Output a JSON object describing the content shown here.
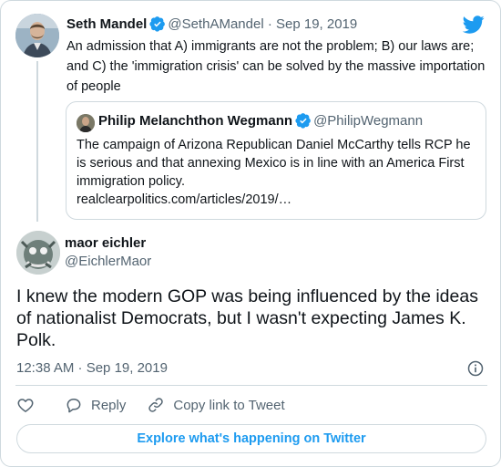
{
  "parent_tweet": {
    "name": "Seth Mandel",
    "handle": "@SethAMandel",
    "separator": "·",
    "date": "Sep 19, 2019",
    "text": "An admission that A) immigrants are not the problem; B) our laws are; and C) the 'immigration crisis' can be solved by the massive importation of people"
  },
  "quoted_tweet": {
    "name": "Philip Melanchthon Wegmann",
    "handle": "@PhilipWegmann",
    "text": "The campaign of Arizona Republican Daniel McCarthy tells RCP he is serious and that annexing Mexico is in line with an America First immigration policy.",
    "link": "realclearpolitics.com/articles/2019/…"
  },
  "main_tweet": {
    "name": "maor eichler",
    "handle": "@EichlerMaor",
    "text": "I knew the modern GOP was being influenced by the ideas of nationalist Democrats, but I wasn't expecting James K. Polk.",
    "timestamp": "12:38 AM · Sep 19, 2019"
  },
  "actions": {
    "reply": "Reply",
    "copy_link": "Copy link to Tweet"
  },
  "explore_label": "Explore what's happening on Twitter",
  "colors": {
    "brand_blue": "#1d9bf0",
    "verified_blue": "#1d9bf0",
    "muted_text": "#536471",
    "border": "#cfd9de"
  },
  "icons": [
    "twitter-bird-icon",
    "verified-badge-icon",
    "info-icon",
    "heart-icon",
    "reply-icon",
    "link-icon"
  ]
}
